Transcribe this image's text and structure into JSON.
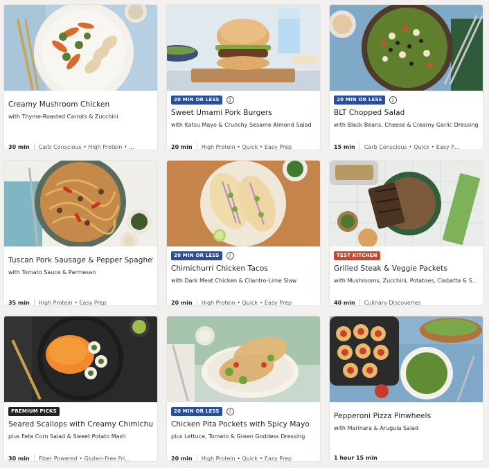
{
  "colors": {
    "badge_quick": "#2b4d9c",
    "badge_test": "#c9472a",
    "badge_premium": "#222222"
  },
  "recipes": [
    {
      "title": "Creamy Mushroom Chicken",
      "subtitle": "with Thyme-Roasted Carrots & Zucchini",
      "time": "30 min",
      "tags": "Carb Conscious • High Protein • …",
      "badge": ""
    },
    {
      "title": "Sweet Umami Pork Burgers",
      "subtitle": "with Katsu Mayo & Crunchy Sesame Almond Salad",
      "time": "20 min",
      "tags": "High Protein • Quick • Easy Prep",
      "badge": "20 MIN OR LESS"
    },
    {
      "title": "BLT Chopped Salad",
      "subtitle": "with Black Beans, Cheese & Creamy Garlic Dressing",
      "time": "15 min",
      "tags": "Carb Conscious • Quick • Easy P…",
      "badge": "20 MIN OR LESS"
    },
    {
      "title": "Tuscan Pork Sausage & Pepper Spaghetti",
      "subtitle": "with Tomato Sauce & Parmesan",
      "time": "35 min",
      "tags": "High Protein • Easy Prep",
      "badge": ""
    },
    {
      "title": "Chimichurri Chicken Tacos",
      "subtitle": "with Dark Meat Chicken & Cilantro-Lime Slaw",
      "time": "20 min",
      "tags": "High Protein • Quick • Easy Prep",
      "badge": "20 MIN OR LESS"
    },
    {
      "title": "Grilled Steak & Veggie Packets",
      "subtitle": "with Mushrooms, Zucchini, Potatoes, Ciabatta & Su…",
      "time": "40 min",
      "tags": "Culinary Discoveries",
      "badge": "TEST KITCHEN"
    },
    {
      "title": "Seared Scallops with Creamy Chimichurri",
      "subtitle": "plus Feta Corn Salad & Sweet Potato Mash",
      "time": "30 min",
      "tags": "Fiber Powered • Gluten-Free Fri…",
      "badge": "PREMIUM PICKS"
    },
    {
      "title": "Chicken Pita Pockets with Spicy Mayo",
      "subtitle": "plus Lettuce, Tomato & Green Goddess Dressing",
      "time": "20 min",
      "tags": "High Protein • Quick • Easy Prep",
      "badge": "20 MIN OR LESS"
    },
    {
      "title": "Pepperoni Pizza Pinwheels",
      "subtitle": "with Marinara & Arugula Salad",
      "time": "1 hour 15 min",
      "tags": "",
      "badge": ""
    }
  ]
}
